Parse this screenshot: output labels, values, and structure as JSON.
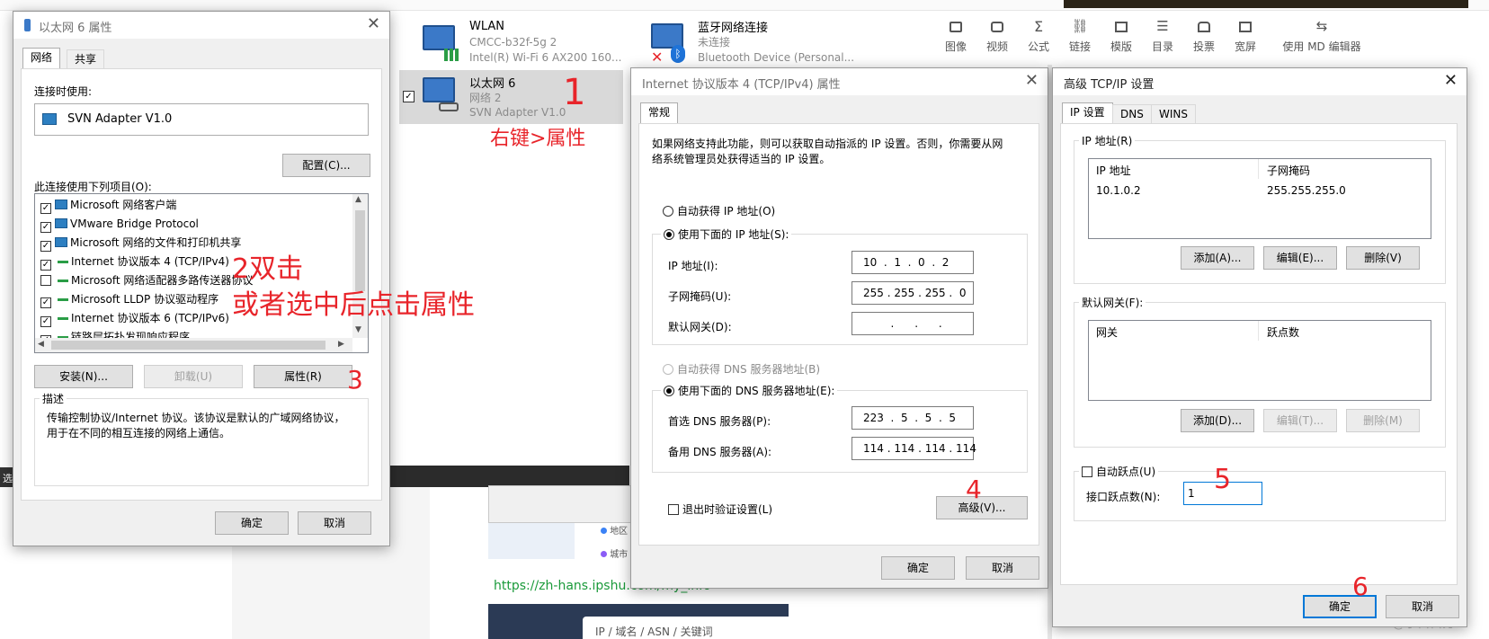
{
  "editor_toolbar": {
    "items": [
      "图像",
      "视频",
      "公式",
      "链接",
      "模版",
      "目录",
      "投票",
      "宽屏",
      "使用 MD 编辑器"
    ]
  },
  "network_connections": {
    "wlan": {
      "name": "WLAN",
      "sub": "CMCC-b32f-5g 2",
      "device": "Intel(R) Wi-Fi 6 AX200 160..."
    },
    "bluetooth": {
      "name": "蓝牙网络连接",
      "sub": "未连接",
      "device": "Bluetooth Device (Personal..."
    },
    "ethernet": {
      "name": "以太网 6",
      "sub": "网络 2",
      "device": "SVN Adapter V1.0"
    }
  },
  "eth_props": {
    "title": "以太网 6 属性",
    "tabs": [
      "网络",
      "共享"
    ],
    "connect_using_label": "连接时使用:",
    "adapter": "SVN Adapter V1.0",
    "configure": "配置(C)...",
    "items_label": "此连接使用下列项目(O):",
    "items": [
      {
        "label": "Microsoft 网络客户端",
        "checked": true,
        "icon": "net"
      },
      {
        "label": "VMware Bridge Protocol",
        "checked": true,
        "icon": "net"
      },
      {
        "label": "Microsoft 网络的文件和打印机共享",
        "checked": true,
        "icon": "net"
      },
      {
        "label": "Internet 协议版本 4 (TCP/IPv4)",
        "checked": true,
        "icon": "proto"
      },
      {
        "label": "Microsoft 网络适配器多路传送器协议",
        "checked": false,
        "icon": "proto"
      },
      {
        "label": "Microsoft LLDP 协议驱动程序",
        "checked": true,
        "icon": "proto"
      },
      {
        "label": "Internet 协议版本 6 (TCP/IPv6)",
        "checked": true,
        "icon": "proto"
      },
      {
        "label": "链路层拓扑发现响应程序",
        "checked": true,
        "icon": "proto"
      }
    ],
    "install": "安装(N)...",
    "uninstall": "卸载(U)",
    "properties": "属性(R)",
    "desc_label": "描述",
    "desc": "传输控制协议/Internet 协议。该协议是默认的广域网络协议，用于在不同的相互连接的网络上通信。",
    "ok": "确定",
    "cancel": "取消"
  },
  "ipv4": {
    "title": "Internet 协议版本 4 (TCP/IPv4) 属性",
    "tab": "常规",
    "intro": "如果网络支持此功能，则可以获取自动指派的 IP 设置。否则，你需要从网络系统管理员处获得适当的 IP 设置。",
    "auto_ip": "自动获得 IP 地址(O)",
    "use_ip": "使用下面的 IP 地址(S):",
    "ip_label": "IP 地址(I):",
    "ip": "10  .  1  .  0  .  2",
    "mask_label": "子网掩码(U):",
    "mask": "255 . 255 . 255 .  0",
    "gw_label": "默认网关(D):",
    "gw": "        .      .      .",
    "auto_dns": "自动获得 DNS 服务器地址(B)",
    "use_dns": "使用下面的 DNS 服务器地址(E):",
    "dns1_label": "首选 DNS 服务器(P):",
    "dns1": "223  .  5  .  5  .  5",
    "dns2_label": "备用 DNS 服务器(A):",
    "dns2": "114 . 114 . 114 . 114",
    "validate": "退出时验证设置(L)",
    "advanced": "高级(V)...",
    "ok": "确定",
    "cancel": "取消"
  },
  "adv": {
    "title": "高级 TCP/IP 设置",
    "tabs": [
      "IP 设置",
      "DNS",
      "WINS"
    ],
    "ip_group": "IP 地址(R)",
    "col_ip": "IP 地址",
    "col_mask": "子网掩码",
    "ip_value": "10.1.0.2",
    "mask_value": "255.255.255.0",
    "add": "添加(A)...",
    "edit": "编辑(E)...",
    "remove": "删除(V)",
    "gw_group": "默认网关(F):",
    "col_gw": "网关",
    "col_metric": "跃点数",
    "gw_add": "添加(D)...",
    "gw_edit": "编辑(T)...",
    "gw_remove": "删除(M)",
    "auto_metric": "自动跃点(U)",
    "metric_label": "接口跃点数(N):",
    "metric_value": "1",
    "ok": "确定",
    "cancel": "取消"
  },
  "annotations": {
    "a1": "1",
    "a1_text": "右键>属性",
    "a2": "2双击",
    "a2b": "或者选中后点击属性",
    "a3": "3",
    "a4": "4",
    "a5": "5",
    "a6": "6"
  },
  "background": {
    "url_text": "https://zh-hans.ipshu.com/my_info",
    "search_placeholder": "IP / 域名 / ASN / 关键词",
    "watermark": "CSDN @小白白方",
    "left_status": "选",
    "region": "地区",
    "city": "城市"
  },
  "colors": {
    "accent": "#0078d7",
    "annotation": "#e8242a",
    "brand_bar": "#2b3a55"
  }
}
